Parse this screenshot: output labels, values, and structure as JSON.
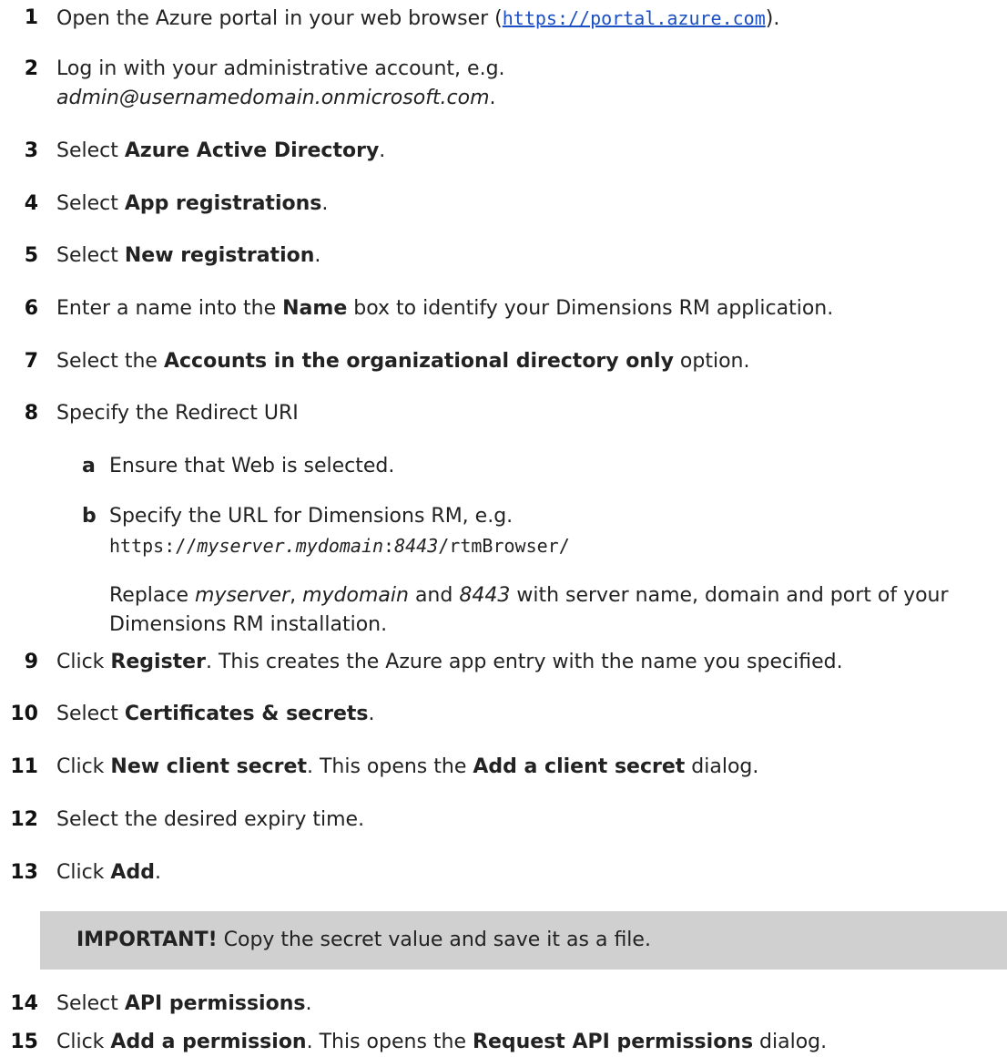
{
  "steps": [
    {
      "n": "1",
      "pre": "Open the Azure portal in your web browser (",
      "link": "https://portal.azure.com",
      "post": ")."
    },
    {
      "n": "2",
      "line1": "Log in with your administrative account, e.g.",
      "italic": "admin@usernamedomain.onmicrosoft.com",
      "post": "."
    },
    {
      "n": "3",
      "pre": "Select ",
      "bold": "Azure Active Directory",
      "post": "."
    },
    {
      "n": "4",
      "pre": "Select ",
      "bold": "App registrations",
      "post": "."
    },
    {
      "n": "5",
      "pre": "Select ",
      "bold": "New registration",
      "post": "."
    },
    {
      "n": "6",
      "pre": "Enter a name into the ",
      "bold": "Name",
      "post": " box to identify your Dimensions RM application."
    },
    {
      "n": "7",
      "pre": "Select the ",
      "bold": "Accounts in the organizational directory only",
      "post": " option."
    },
    {
      "n": "8",
      "text": "Specify the Redirect URI",
      "sub_a": {
        "letter": "a",
        "text": "Ensure that Web is selected."
      },
      "sub_b": {
        "letter": "b",
        "line1": "Specify the URL for Dimensions RM, e.g.",
        "url_pre": "https://",
        "url_i1": "myserver.mydomain",
        "url_colon": ":",
        "url_i2": "8443",
        "url_post": "/rtmBrowser/",
        "replace_pre": "Replace ",
        "replace_i1": "myserver",
        "replace_sep1": ", ",
        "replace_i2": "mydomain",
        "replace_and": " and ",
        "replace_i3": "8443",
        "replace_post": " with server name, domain and port of your",
        "replace_line2": "Dimensions RM installation."
      }
    },
    {
      "n": "9",
      "pre": "Click ",
      "bold": "Register",
      "post": ". This creates the Azure app entry with the name you specified."
    },
    {
      "n": "10",
      "pre": "Select ",
      "bold": "Certificates & secrets",
      "post": "."
    },
    {
      "n": "11",
      "pre": "Click ",
      "bold": "New client secret",
      "mid": ". This opens the ",
      "bold2": "Add a client secret",
      "post": " dialog."
    },
    {
      "n": "12",
      "text": "Select the desired expiry time."
    },
    {
      "n": "13",
      "pre": "Click ",
      "bold": "Add",
      "post": "."
    },
    {
      "n": "14",
      "pre": "Select ",
      "bold": "API permissions",
      "post": "."
    },
    {
      "n": "15",
      "pre": "Click ",
      "bold": "Add a permission",
      "mid": ". This opens the ",
      "bold2": "Request API permissions",
      "post": " dialog."
    }
  ],
  "note": {
    "label": "IMPORTANT!",
    "text": "  Copy the secret value and save it as a file."
  }
}
